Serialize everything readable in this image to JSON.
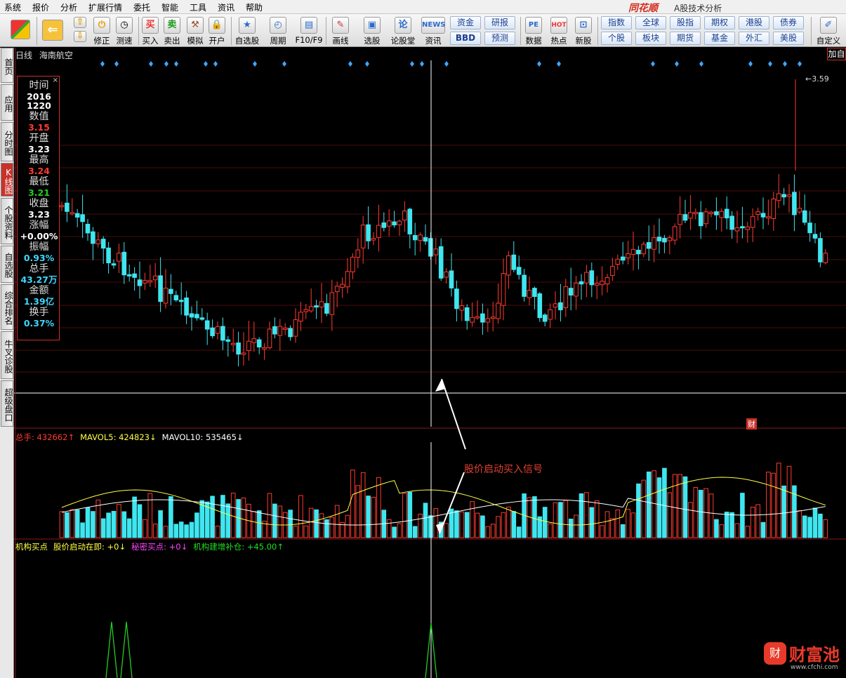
{
  "menu": [
    "系统",
    "报价",
    "分析",
    "扩展行情",
    "委托",
    "智能",
    "工具",
    "资讯",
    "帮助"
  ],
  "brand": "同花顺",
  "app_title": "A股技术分析",
  "toolbar": {
    "buttons": [
      "修正",
      "测速",
      "买入",
      "卖出",
      "模拟",
      "开户",
      "自选股",
      "周期",
      "F10/F9",
      "画线",
      "选股",
      "论股堂",
      "资讯",
      "数据",
      "热点",
      "新股",
      "自定义"
    ],
    "buy_icon": "买",
    "sell_icon": "卖",
    "news_icon": "NEWS",
    "data_icon": "PE",
    "hot_icon": "HOT",
    "grid1": [
      "资金",
      "研报",
      "BBD",
      "预测"
    ],
    "grid2": [
      "指数",
      "全球",
      "股指",
      "期权",
      "港股",
      "债券",
      "个股",
      "板块",
      "期货",
      "基金",
      "外汇",
      "美股"
    ]
  },
  "side_tabs": [
    "首页",
    "应用",
    "分时图",
    "K线图",
    "个股资料",
    "自选股",
    "综合排名",
    "牛叉诊股",
    "超级盘口"
  ],
  "chart": {
    "period": "日线",
    "stock_name": "海南航空",
    "add_button": "加自",
    "max_price_label": "3.59",
    "cai_tag": "财",
    "annotation": "股价启动买入信号"
  },
  "info_panel": {
    "close": "×",
    "rows": [
      {
        "label": "时间",
        "value": "2016",
        "value2": "1220",
        "color": "#ffffff"
      },
      {
        "label": "数值",
        "value": "3.15",
        "color": "#ff3b30"
      },
      {
        "label": "开盘",
        "value": "3.23",
        "color": "#ffffff"
      },
      {
        "label": "最高",
        "value": "3.24",
        "color": "#ff3b30"
      },
      {
        "label": "最低",
        "value": "3.21",
        "color": "#22cc22"
      },
      {
        "label": "收盘",
        "value": "3.23",
        "color": "#ffffff"
      },
      {
        "label": "涨幅",
        "value": "+0.00%",
        "color": "#ffffff"
      },
      {
        "label": "振幅",
        "value": "0.93%",
        "color": "#3fd7ff"
      },
      {
        "label": "总手",
        "value": "43.27万",
        "color": "#3fd7ff"
      },
      {
        "label": "金额",
        "value": "1.39亿",
        "color": "#3fd7ff"
      },
      {
        "label": "换手",
        "value": "0.37%",
        "color": "#3fd7ff"
      }
    ]
  },
  "vol_legend": [
    {
      "text": "总手: 432662",
      "arrow": "↑",
      "color": "#ff3b30"
    },
    {
      "text": "MAVOL5: 424823",
      "arrow": "↓",
      "color": "#ffff44"
    },
    {
      "text": "MAVOL10: 535465",
      "arrow": "↓",
      "color": "#ffffff"
    }
  ],
  "ind_legend": [
    {
      "text": "机构买点",
      "arrow": "",
      "color": "#ffff44"
    },
    {
      "text": "股价启动在即: +0",
      "arrow": "↓",
      "color": "#ffff44"
    },
    {
      "text": "秘密买点: +0",
      "arrow": "↓",
      "color": "#ff44ff"
    },
    {
      "text": "机构建增补仓: +45.00",
      "arrow": "↑",
      "color": "#22dd22"
    }
  ],
  "watermark": {
    "brand": "财富池",
    "url": "www.cfchi.com"
  },
  "colors": {
    "up": "#ff3b30",
    "down": "#3fe6f0",
    "ma5": "#ffff44",
    "ma10": "#ffffff",
    "signal": "#22cc22",
    "diamond": "#3fa7ff"
  }
}
